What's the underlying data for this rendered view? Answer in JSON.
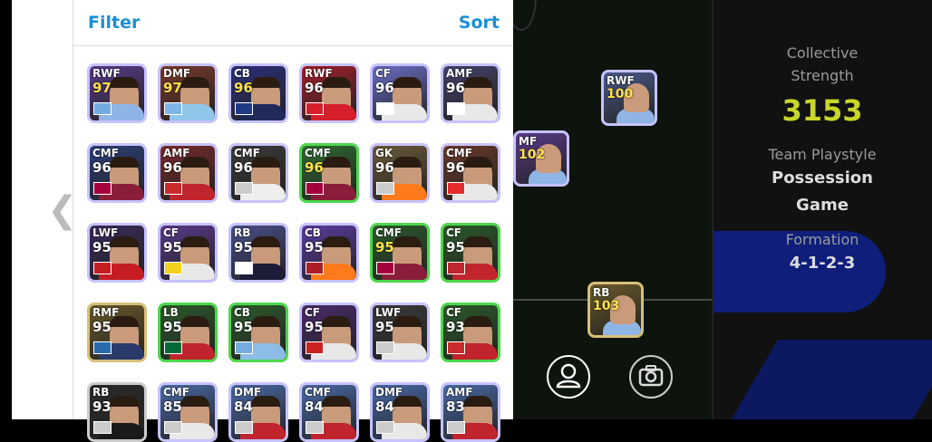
{
  "header": {
    "filter_label": "Filter",
    "sort_label": "Sort"
  },
  "nav": {
    "back_icon": "chevron-left-icon"
  },
  "players": [
    {
      "pos": "RWF",
      "rating": "97",
      "rating_gold": true,
      "bg": "#5a3b8a",
      "shirt": "#8fb5e6",
      "flag": "#74acdf",
      "border": "#c6c3ff"
    },
    {
      "pos": "DMF",
      "rating": "97",
      "rating_gold": true,
      "bg": "#7a3a2a",
      "shirt": "#90c6ea",
      "flag": "#7fb6e8",
      "border": "#c6c3ff"
    },
    {
      "pos": "CB",
      "rating": "96",
      "rating_gold": true,
      "bg": "#2b2f7a",
      "shirt": "#202a5a",
      "flag": "#1f3a86",
      "border": "#c6c3ff"
    },
    {
      "pos": "RWF",
      "rating": "96",
      "rating_gold": false,
      "bg": "#a21f2a",
      "shirt": "#d51f2a",
      "flag": "#d51f2a",
      "border": "#c6c3ff"
    },
    {
      "pos": "CF",
      "rating": "96",
      "rating_gold": false,
      "bg": "#6b6ec7",
      "shirt": "#e8e8e8",
      "flag": "#ffffff",
      "border": "#c6c3ff"
    },
    {
      "pos": "AMF",
      "rating": "96",
      "rating_gold": false,
      "bg": "#45426b",
      "shirt": "#e8e8e8",
      "flag": "#ffffff",
      "border": "#c6c3ff"
    },
    {
      "pos": "CMF",
      "rating": "96",
      "rating_gold": false,
      "bg": "#2c3f7a",
      "shirt": "#8a1e3a",
      "flag": "#a5003c",
      "border": "#c6c3ff"
    },
    {
      "pos": "AMF",
      "rating": "96",
      "rating_gold": false,
      "bg": "#7a2a2a",
      "shirt": "#c0242c",
      "flag": "#cc2b2b",
      "border": "#c6c3ff"
    },
    {
      "pos": "CMF",
      "rating": "96",
      "rating_gold": false,
      "bg": "#3b3b3b",
      "shirt": "#eeeeee",
      "flag": "#cccccc",
      "border": "#c6c3ff"
    },
    {
      "pos": "CMF",
      "rating": "96",
      "rating_gold": true,
      "bg": "#2f6b2f",
      "shirt": "#8a1e3a",
      "flag": "#a5003c",
      "border": "#4dd84d"
    },
    {
      "pos": "GK",
      "rating": "96",
      "rating_gold": false,
      "bg": "#6b5a3a",
      "shirt": "#ff7a1a",
      "flag": "#cccccc",
      "border": "#c6c3ff"
    },
    {
      "pos": "CMF",
      "rating": "96",
      "rating_gold": false,
      "bg": "#6a3a2a",
      "shirt": "#e8e8e8",
      "flag": "#e52b2b",
      "border": "#c6c3ff"
    },
    {
      "pos": "LWF",
      "rating": "95",
      "rating_gold": false,
      "bg": "#3a2a5a",
      "shirt": "#c61d23",
      "flag": "#c61d23",
      "border": "#c6c3ff"
    },
    {
      "pos": "CF",
      "rating": "95",
      "rating_gold": false,
      "bg": "#5a3a8a",
      "shirt": "#e8e8e8",
      "flag": "#f2d11c",
      "border": "#c6c3ff"
    },
    {
      "pos": "RB",
      "rating": "95",
      "rating_gold": false,
      "bg": "#4a4f8a",
      "shirt": "#1d1d38",
      "flag": "#ffffff",
      "border": "#c6c3ff"
    },
    {
      "pos": "CB",
      "rating": "95",
      "rating_gold": false,
      "bg": "#5c3ca0",
      "shirt": "#ff7a1a",
      "flag": "#ae1c28",
      "border": "#c6c3ff"
    },
    {
      "pos": "CMF",
      "rating": "95",
      "rating_gold": true,
      "bg": "#2c5a2a",
      "shirt": "#8a1e3a",
      "flag": "#a5003c",
      "border": "#4dd84d"
    },
    {
      "pos": "CF",
      "rating": "95",
      "rating_gold": false,
      "bg": "#2c5a2a",
      "shirt": "#c0242c",
      "flag": "#c0242c",
      "border": "#4dd84d"
    },
    {
      "pos": "RMF",
      "rating": "95",
      "rating_gold": false,
      "bg": "#6a5a2a",
      "shirt": "#2a3a6a",
      "flag": "#2a6aaa",
      "border": "#d6c07a"
    },
    {
      "pos": "LB",
      "rating": "95",
      "rating_gold": false,
      "bg": "#2c5a2a",
      "shirt": "#c0242c",
      "flag": "#046a38",
      "border": "#4dd84d"
    },
    {
      "pos": "CB",
      "rating": "95",
      "rating_gold": false,
      "bg": "#2c5a2a",
      "shirt": "#8dbde6",
      "flag": "#74acdf",
      "border": "#4dd84d"
    },
    {
      "pos": "CF",
      "rating": "95",
      "rating_gold": false,
      "bg": "#4a2a6a",
      "shirt": "#e8e8e8",
      "flag": "#cc2222",
      "border": "#c6c3ff"
    },
    {
      "pos": "LWF",
      "rating": "95",
      "rating_gold": false,
      "bg": "#3a3a3a",
      "shirt": "#e8e8e8",
      "flag": "#cccccc",
      "border": "#c6c3ff"
    },
    {
      "pos": "CF",
      "rating": "93",
      "rating_gold": false,
      "bg": "#2c5a2a",
      "shirt": "#c0242c",
      "flag": "#cc2b2b",
      "border": "#4dd84d"
    },
    {
      "pos": "RB",
      "rating": "93",
      "rating_gold": false,
      "bg": "#2a2a2a",
      "shirt": "#1a1a1a",
      "flag": "#cccccc",
      "border": "#cccccc"
    },
    {
      "pos": "CMF",
      "rating": "85",
      "rating_gold": false,
      "bg": "#4a6aa6",
      "shirt": "#e8e8e8",
      "flag": "#cccccc",
      "border": "#c6c3ff"
    },
    {
      "pos": "DMF",
      "rating": "84",
      "rating_gold": false,
      "bg": "#4a6aa6",
      "shirt": "#c0242c",
      "flag": "#cccccc",
      "border": "#c6c3ff"
    },
    {
      "pos": "CMF",
      "rating": "84",
      "rating_gold": false,
      "bg": "#4a6aa6",
      "shirt": "#c0242c",
      "flag": "#cccccc",
      "border": "#c6c3ff"
    },
    {
      "pos": "DMF",
      "rating": "84",
      "rating_gold": false,
      "bg": "#4a6aa6",
      "shirt": "#e8e8e8",
      "flag": "#cccccc",
      "border": "#c6c3ff"
    },
    {
      "pos": "AMF",
      "rating": "83",
      "rating_gold": false,
      "bg": "#4a6aa6",
      "shirt": "#c0242c",
      "flag": "#cccccc",
      "border": "#c6c3ff"
    }
  ],
  "pitch_players": [
    {
      "pos": "RWF",
      "rating": "100",
      "gold": true,
      "bg": "#4a5a8a",
      "border": "#c6c3ff"
    },
    {
      "pos": "MF",
      "rating": "102",
      "gold": true,
      "bg": "#5a3b8a",
      "border": "#c6c3ff"
    },
    {
      "pos": "RB",
      "rating": "103",
      "gold": true,
      "bg": "#6a5a2a",
      "border": "#d6c07a"
    }
  ],
  "stats": {
    "collective_label_1": "Collective",
    "collective_label_2": "Strength",
    "collective_value": "3153",
    "team_playstyle_label": "Team Playstyle",
    "team_playstyle_value_1": "Possession",
    "team_playstyle_value_2": "Game",
    "formation_label": "Formation",
    "formation_value": "4-1-2-3"
  },
  "actions": {
    "profile_icon": "person-icon",
    "camera_icon": "camera-icon"
  }
}
